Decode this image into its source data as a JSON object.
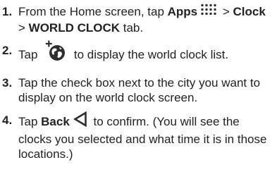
{
  "steps": [
    {
      "number": "1.",
      "t1": "From the Home screen, tap ",
      "b1": "Apps",
      "icon": "apps-grid-icon",
      "t2": " > ",
      "b2": "Clock",
      "t3": " > ",
      "b3": "WORLD CLOCK",
      "t4": " tab."
    },
    {
      "number": "2.",
      "t1": "Tap ",
      "icon": "add-city-globe-icon",
      "t2": " to display the world clock list."
    },
    {
      "number": "3.",
      "t1": "Tap the check box next to the city you want to display on the world clock screen."
    },
    {
      "number": "4.",
      "t1": "Tap ",
      "b1": "Back",
      "icon": "back-triangle-icon",
      "t2": " to confirm. (You will see the clocks you selected and what time it is in those locations.)"
    }
  ],
  "colors": {
    "text": "#222222",
    "icon": "#2f2f2f"
  }
}
